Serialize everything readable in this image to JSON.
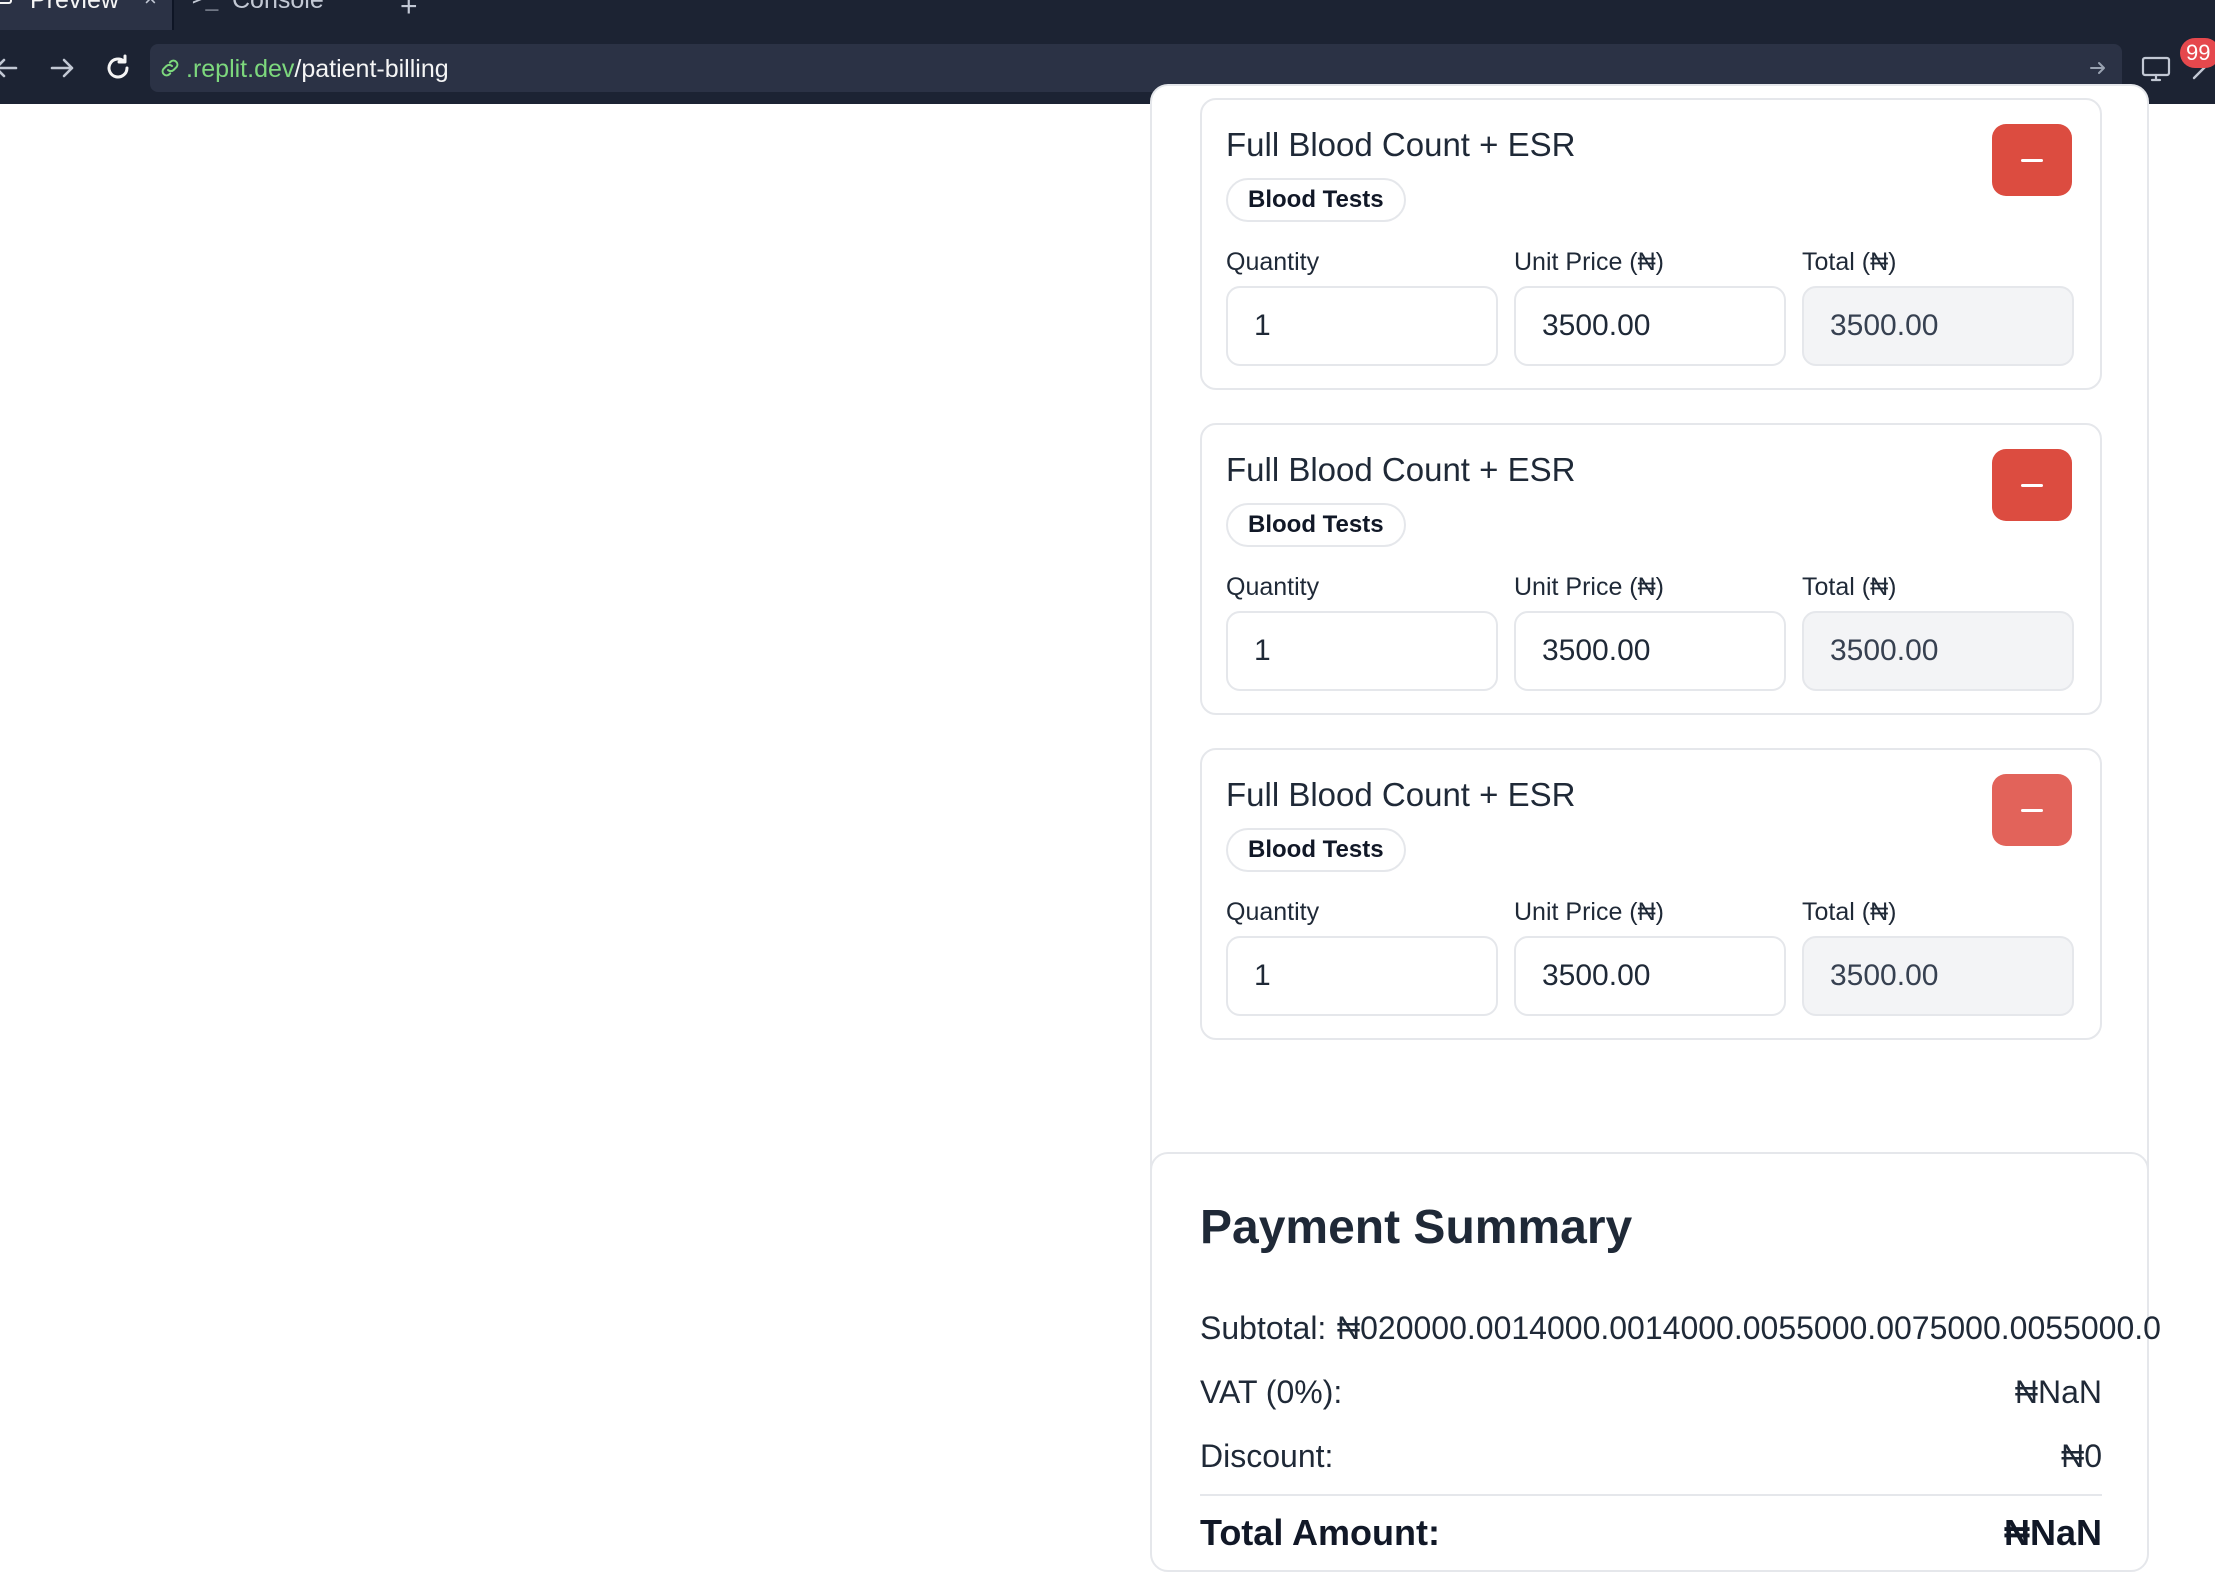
{
  "browser": {
    "tabs": [
      {
        "label": "Preview",
        "close": "×"
      },
      {
        "label": "Console"
      }
    ],
    "add_tab": "+",
    "url": {
      "domain": ".replit.dev",
      "path": "/patient-billing"
    },
    "badge_count": "99"
  },
  "items": [
    {
      "name": "Full Blood Count + ESR",
      "category": "Blood Tests",
      "quantity_label": "Quantity",
      "quantity": "1",
      "unit_price_label": "Unit Price (₦)",
      "unit_price": "3500.00",
      "total_label": "Total (₦)",
      "total": "3500.00"
    },
    {
      "name": "Full Blood Count + ESR",
      "category": "Blood Tests",
      "quantity_label": "Quantity",
      "quantity": "1",
      "unit_price_label": "Unit Price (₦)",
      "unit_price": "3500.00",
      "total_label": "Total (₦)",
      "total": "3500.00"
    },
    {
      "name": "Full Blood Count + ESR",
      "category": "Blood Tests",
      "quantity_label": "Quantity",
      "quantity": "1",
      "unit_price_label": "Unit Price (₦)",
      "unit_price": "3500.00",
      "total_label": "Total (₦)",
      "total": "3500.00"
    }
  ],
  "summary": {
    "title": "Payment Summary",
    "subtotal_label": "Subtotal:",
    "subtotal_value": "₦020000.0014000.0014000.0055000.0075000.0055000.0",
    "vat_label": "VAT (0%):",
    "vat_value": "₦NaN",
    "discount_label": "Discount:",
    "discount_value": "₦0",
    "total_label": "Total Amount:",
    "total_value": "₦NaN"
  },
  "colors": {
    "chrome_bg": "#1c2333",
    "remove_button": "#dc4c40",
    "url_domain": "#7dd87d",
    "badge": "#e5484d"
  }
}
